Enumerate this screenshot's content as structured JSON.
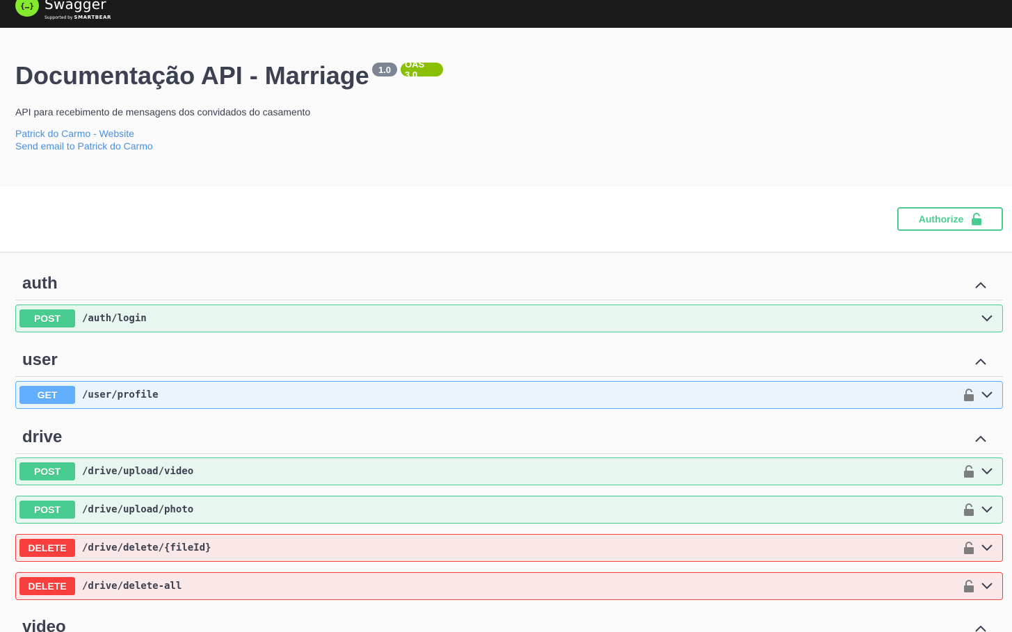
{
  "topbar": {
    "logo_text": "Swagger",
    "logo_sub_prefix": "Supported by",
    "logo_sub_brand": "SMARTBEAR",
    "logo_glyph": "{…}"
  },
  "info": {
    "title": "Documentação API - Marriage",
    "version": "1.0",
    "oas": "OAS 3.0",
    "description": "API para recebimento de mensagens dos convidados do casamento",
    "website_link": "Patrick do Carmo - Website",
    "email_link": "Send email to Patrick do Carmo"
  },
  "authorize": {
    "label": "Authorize",
    "icon": "unlock-icon"
  },
  "tags": [
    {
      "name": "auth"
    },
    {
      "name": "user"
    },
    {
      "name": "drive"
    },
    {
      "name": "video"
    }
  ],
  "operations": [
    {
      "method": "POST",
      "path": "/auth/login",
      "locked": false
    },
    {
      "method": "GET",
      "path": "/user/profile",
      "locked": true
    },
    {
      "method": "POST",
      "path": "/drive/upload/video",
      "locked": true
    },
    {
      "method": "POST",
      "path": "/drive/upload/photo",
      "locked": true
    },
    {
      "method": "DELETE",
      "path": "/drive/delete/{fileId}",
      "locked": true
    },
    {
      "method": "DELETE",
      "path": "/drive/delete-all",
      "locked": true
    }
  ],
  "colors": {
    "post": "#49cc90",
    "get": "#61affe",
    "delete": "#f93e3e",
    "topbar": "#1b1b1b",
    "logo": "#85ea2d",
    "link": "#4990e2"
  }
}
